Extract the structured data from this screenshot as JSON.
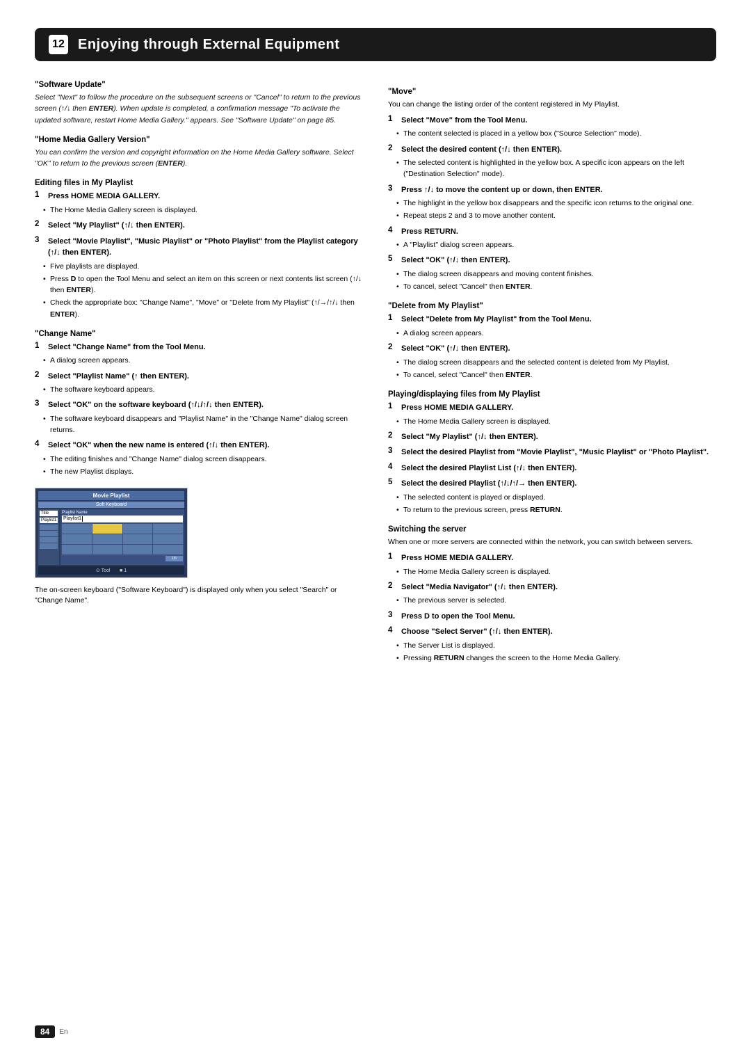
{
  "chapter": {
    "number": "12",
    "title": "Enjoying through External Equipment"
  },
  "page_number": "84",
  "page_lang": "En",
  "left_column": {
    "software_update": {
      "title": "\"Software Update\"",
      "body": "Select \"Next\" to follow the procedure on the subsequent screens or \"Cancel\" to return to the previous screen (↑/↓ then ENTER). When update is completed, a confirmation message \"To activate the updated software, restart Home Media Gallery.\" appears. See \"Software Update\" on page 85."
    },
    "home_media_gallery_version": {
      "title": "\"Home Media Gallery Version\"",
      "body": "You can confirm the version and copyright information on the Home Media Gallery software. Select \"OK\" to return to the previous screen (ENTER)."
    },
    "editing_files": {
      "title": "Editing files in My Playlist",
      "steps": [
        {
          "num": "1",
          "text": "Press HOME MEDIA GALLERY.",
          "bullets": [
            "The Home Media Gallery screen is displayed."
          ]
        },
        {
          "num": "2",
          "text": "Select \"My Playlist\" (↑/↓ then ENTER).",
          "bullets": []
        },
        {
          "num": "3",
          "text": "Select \"Movie Playlist\", \"Music Playlist\" or \"Photo Playlist\" from the Playlist category (↑/↓ then ENTER).",
          "bullets": [
            "Five playlists are displayed.",
            "Press D to open the Tool Menu and select an item on this screen or next contents list screen (↑/↓ then ENTER).",
            "Check the appropriate box: \"Change Name\", \"Move\" or \"Delete from My Playlist\" (↑/→/↑/↓ then ENTER)."
          ]
        }
      ]
    },
    "change_name": {
      "title": "\"Change Name\"",
      "steps": [
        {
          "num": "1",
          "text": "Select \"Change Name\" from the Tool Menu.",
          "bullets": [
            "A dialog screen appears."
          ]
        },
        {
          "num": "2",
          "text": "Select \"Playlist Name\" (↑ then ENTER).",
          "bullets": [
            "The software keyboard appears."
          ]
        },
        {
          "num": "3",
          "text": "Select \"OK\" on the software keyboard (↑/↓/↑/↓ then ENTER).",
          "bullets": [
            "The software keyboard disappears and \"Playlist Name\" in the \"Change Name\" dialog screen returns."
          ]
        },
        {
          "num": "4",
          "text": "Select \"OK\" when the new name is entered (↑/↓ then ENTER).",
          "bullets": [
            "The editing finishes and \"Change Name\" dialog screen disappears.",
            "The new Playlist displays."
          ]
        }
      ]
    },
    "keyboard_note": "The on-screen keyboard (\"Software Keyboard\") is displayed only when you select \"Search\" or \"Change Name\"."
  },
  "right_column": {
    "move": {
      "title": "\"Move\"",
      "intro": "You can change the listing order of the content registered in My Playlist.",
      "steps": [
        {
          "num": "1",
          "text": "Select \"Move\" from the Tool Menu.",
          "bullets": [
            "The content selected is placed in a yellow box (\"Source Selection\" mode)."
          ]
        },
        {
          "num": "2",
          "text": "Select the desired content (↑/↓ then ENTER).",
          "bullets": [
            "The selected content is highlighted in the yellow box. A specific icon appears on the left (\"Destination Selection\" mode)."
          ]
        },
        {
          "num": "3",
          "text": "Press ↑/↓ to move the content up or down, then ENTER.",
          "bullets": [
            "The highlight in the yellow box disappears and the specific icon returns to the original one.",
            "Repeat steps 2 and 3 to move another content."
          ]
        },
        {
          "num": "4",
          "text": "Press RETURN.",
          "bullets": [
            "A \"Playlist\" dialog screen appears."
          ]
        },
        {
          "num": "5",
          "text": "Select \"OK\" (↑/↓ then ENTER).",
          "bullets": [
            "The dialog screen disappears and moving content finishes.",
            "To cancel, select \"Cancel\" then ENTER."
          ]
        }
      ]
    },
    "delete_from_playlist": {
      "title": "\"Delete from My Playlist\"",
      "steps": [
        {
          "num": "1",
          "text": "Select \"Delete from My Playlist\" from the Tool Menu.",
          "bullets": [
            "A dialog screen appears."
          ]
        },
        {
          "num": "2",
          "text": "Select \"OK\" (↑/↓ then ENTER).",
          "bullets": [
            "The dialog screen disappears and the selected content is deleted from My Playlist.",
            "To cancel, select \"Cancel\" then ENTER."
          ]
        }
      ]
    },
    "playing_files": {
      "title": "Playing/displaying files from My Playlist",
      "steps": [
        {
          "num": "1",
          "text": "Press HOME MEDIA GALLERY.",
          "bullets": [
            "The Home Media Gallery screen is displayed."
          ]
        },
        {
          "num": "2",
          "text": "Select \"My Playlist\" (↑/↓ then ENTER).",
          "bullets": [
            ""
          ]
        },
        {
          "num": "3",
          "text": "Select the desired Playlist from \"Movie Playlist\", \"Music Playlist\" or \"Photo Playlist\".",
          "bullets": []
        },
        {
          "num": "4",
          "text": "Select the desired Playlist List (↑/↓ then ENTER).",
          "bullets": []
        },
        {
          "num": "5",
          "text": "Select the desired Playlist (↑/↓/↑/→ then ENTER).",
          "bullets": [
            "The selected content is played or displayed.",
            "To return to the previous screen, press RETURN."
          ]
        }
      ]
    },
    "switching_server": {
      "title": "Switching the server",
      "intro": "When one or more servers are connected within the network, you can switch between servers.",
      "steps": [
        {
          "num": "1",
          "text": "Press HOME MEDIA GALLERY.",
          "bullets": [
            "The Home Media Gallery screen is displayed."
          ]
        },
        {
          "num": "2",
          "text": "Select \"Media Navigator\" (↑/↓ then ENTER).",
          "bullets": [
            "The previous server is selected."
          ]
        },
        {
          "num": "3",
          "text": "Press D to open the Tool Menu.",
          "bullets": []
        },
        {
          "num": "4",
          "text": "Choose \"Select Server\" (↑/↓ then ENTER).",
          "bullets": [
            "The Server List is displayed.",
            "Pressing RETURN changes the screen to the Home Media Gallery."
          ]
        }
      ]
    }
  }
}
